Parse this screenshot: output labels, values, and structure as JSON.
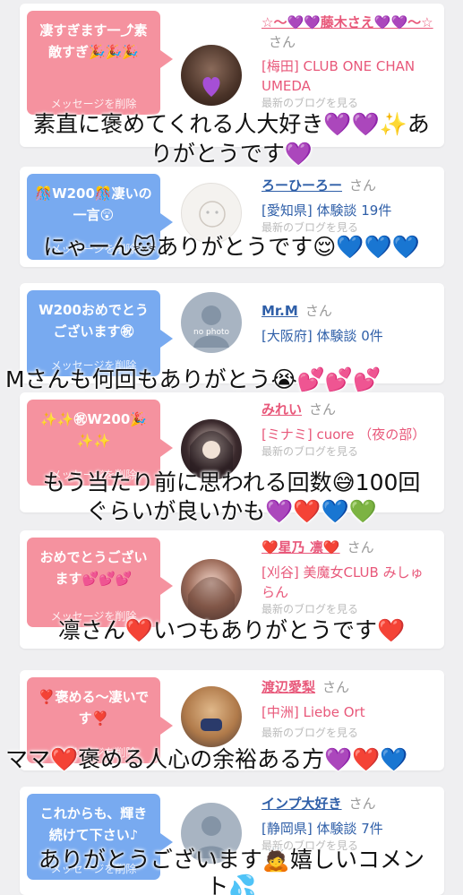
{
  "cards": [
    {
      "message": "凄すぎます一⤴素敵すぎ🎉🎉🎉",
      "delete_label": "メッセージを削除",
      "name": "☆〜💜💜藤木さえ💜💜〜☆",
      "honorific": "さん",
      "meta": "[梅田] CLUB ONE CHAN UMEDA",
      "blog": "最新のブログを見る"
    },
    {
      "message": "🎊W200🎊凄いの一言😲",
      "delete_label": "メッセージを削除",
      "name": "ろーひーろー",
      "honorific": "さん",
      "meta": "[愛知県] 体験談 19件",
      "blog": "最新のブログを見る"
    },
    {
      "message": "W200おめでとうございます㊗",
      "delete_label": "メッセージを削除",
      "name": "Mr.M",
      "honorific": "さん",
      "meta": "[大阪府] 体験談 0件",
      "avatar_text": "no photo"
    },
    {
      "message": "✨✨㊗W200🎉✨✨",
      "delete_label": "メッセージを削除",
      "name": "みれい",
      "honorific": "さん",
      "meta": "[ミナミ] cuore （夜の部）",
      "blog": "最新のブログを見る"
    },
    {
      "message": "おめでとうございます💕💕💕",
      "delete_label": "メッセージを削除",
      "name": "❤️星乃 凛❤️",
      "honorific": "さん",
      "meta": "[刈谷] 美魔女CLUB みしゅらん",
      "blog": "最新のブログを見る"
    },
    {
      "message": "❣️褒める〜凄いです❣️",
      "delete_label": "メッセージを削除",
      "name": "渡辺愛梨",
      "honorific": "さん",
      "meta": "[中洲] Liebe Ort",
      "blog": "最新のブログを見る"
    },
    {
      "message": "これからも、輝き続けて下さい♪",
      "delete_label": "メッセージを削除",
      "name": "インプ大好き",
      "honorific": "さん",
      "meta": "[静岡県] 体験談 7件",
      "blog": "最新のブログを見る"
    }
  ],
  "captions": [
    "素直に褒めてくれる人大好き💜💜✨あ",
    "りがとうです💜",
    "にゃーん🐱ありがとうです😌💙💙💙",
    "Mさんも何回もありがとう😭💕💕💕",
    "もう当たり前に思われる回数😅100回",
    "ぐらいが良いかも💜❤️💙💚",
    "凛さん❤️いつもありがとうです❤️",
    "ママ❤️褒める人心の余裕ある方💜❤️💙",
    "ありがとうございます🙇嬉しいコメン",
    "ト💦"
  ],
  "colors": {
    "pink_bubble": "#f5929f",
    "blue_bubble": "#78aaf0",
    "pink_text": "#e8587a",
    "blue_text": "#2f5fa8"
  }
}
